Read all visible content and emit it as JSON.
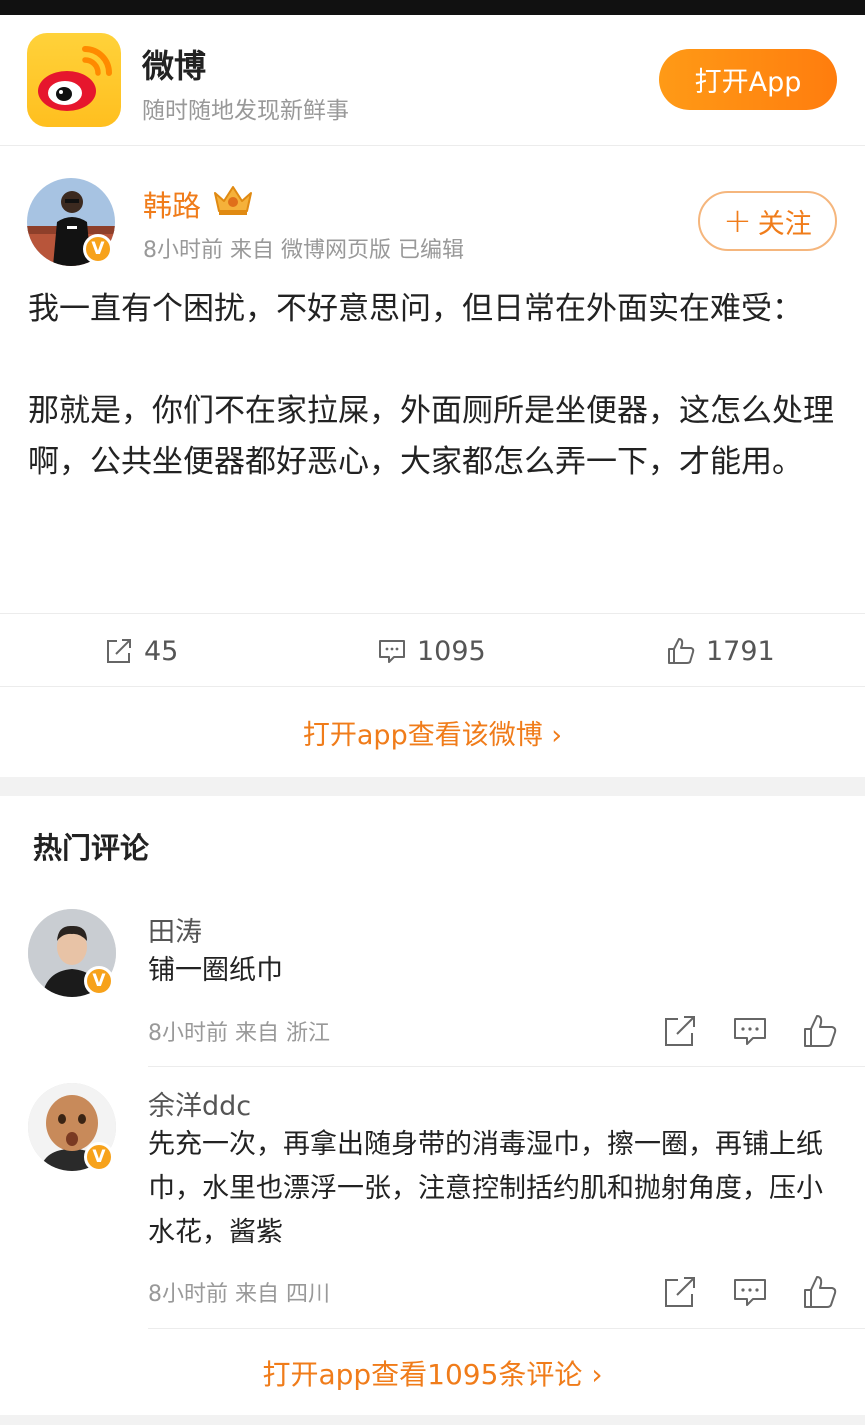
{
  "app_header": {
    "name": "微博",
    "slogan": "随时随地发现新鲜事",
    "open_app_label": "打开App"
  },
  "post": {
    "author": "韩路",
    "meta": "8小时前  来自 微博网页版 已编辑",
    "follow_label": "关注",
    "paragraphs": [
      "我一直有个困扰，不好意思问，但日常在外面实在难受：",
      "那就是，你们不在家拉屎，外面厕所是坐便器，这怎么处理啊，公共坐便器都好恶心，大家都怎么弄一下，才能用。"
    ],
    "reposts": "45",
    "comments": "1095",
    "likes": "1791",
    "view_link": "打开app查看该微博 ›"
  },
  "comments_section": {
    "title": "热门评论",
    "items": [
      {
        "name": "田涛",
        "text": "铺一圈纸巾",
        "meta": "8小时前 来自 浙江"
      },
      {
        "name": "余洋ddc",
        "text": "先充一次，再拿出随身带的消毒湿巾，擦一圈，再铺上纸巾，水里也漂浮一张，注意控制括约肌和抛射角度，压小水花，酱紫",
        "meta": "8小时前 来自 四川"
      }
    ],
    "view_all_link": "打开app查看1095条评论 ›"
  },
  "colors": {
    "accent": "#f07c1a",
    "button_gradient_start": "#ff9a16",
    "button_gradient_end": "#ff7d0e",
    "verify_badge": "#f7a21b"
  },
  "icons": {
    "repost": "share-icon",
    "comment": "comment-icon",
    "like": "thumbs-up-icon",
    "verified": "verified-v-icon",
    "crown": "crown-icon"
  }
}
